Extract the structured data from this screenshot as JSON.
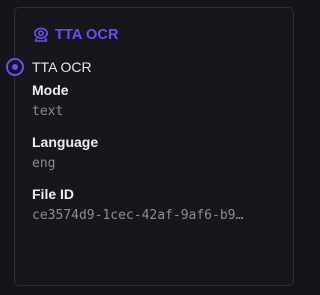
{
  "node": {
    "title": "TTA OCR",
    "icon": "camera-lens-icon",
    "accent_color": "#6d4cf2",
    "output_label": "TTA OCR",
    "fields": [
      {
        "label": "Mode",
        "value": "text"
      },
      {
        "label": "Language",
        "value": "eng"
      },
      {
        "label": "File ID",
        "value": "ce3574d9-1cec-42af-9af6-b9…"
      }
    ]
  }
}
